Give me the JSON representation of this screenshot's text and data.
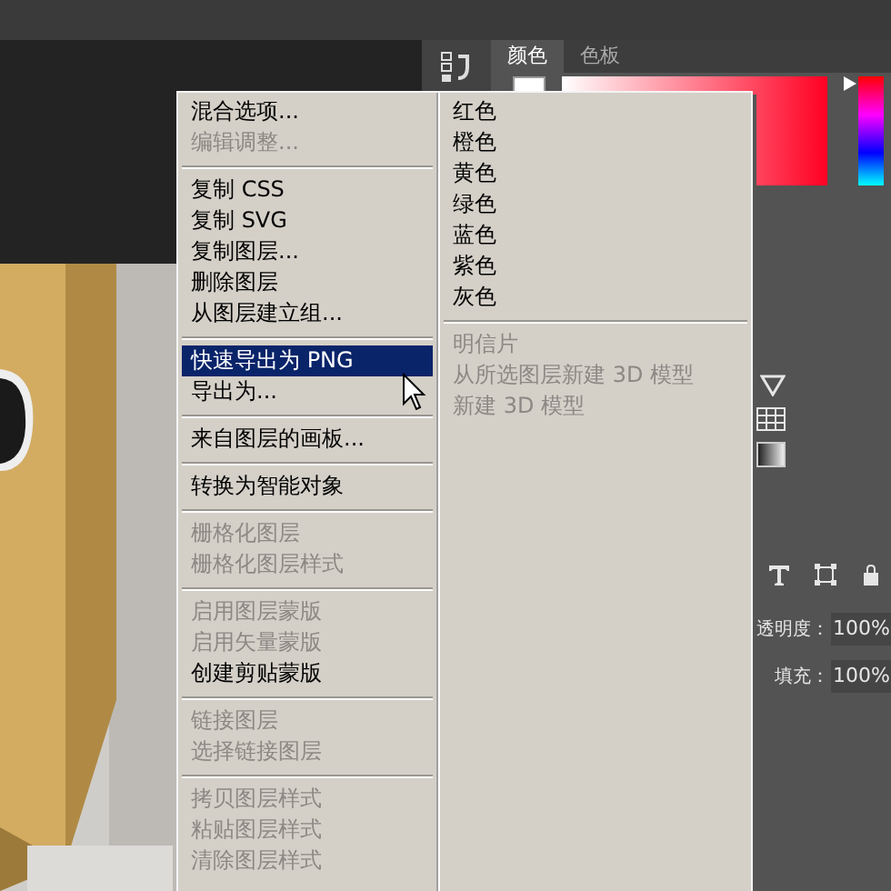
{
  "panel_tabs": [
    {
      "label": "颜色",
      "selected": true
    },
    {
      "label": "色板",
      "selected": false
    }
  ],
  "context_menu": {
    "columns": [
      {
        "items": [
          {
            "kind": "item",
            "label": "混合选项...",
            "disabled": false,
            "selected": false
          },
          {
            "kind": "item",
            "label": "编辑调整...",
            "disabled": true,
            "selected": false
          },
          {
            "kind": "separator"
          },
          {
            "kind": "item",
            "label": "复制 CSS",
            "disabled": false,
            "selected": false
          },
          {
            "kind": "item",
            "label": "复制 SVG",
            "disabled": false,
            "selected": false
          },
          {
            "kind": "item",
            "label": "复制图层...",
            "disabled": false,
            "selected": false
          },
          {
            "kind": "item",
            "label": "删除图层",
            "disabled": false,
            "selected": false
          },
          {
            "kind": "item",
            "label": "从图层建立组...",
            "disabled": false,
            "selected": false
          },
          {
            "kind": "separator"
          },
          {
            "kind": "item",
            "label": "快速导出为 PNG",
            "disabled": false,
            "selected": true
          },
          {
            "kind": "item",
            "label": "导出为...",
            "disabled": false,
            "selected": false
          },
          {
            "kind": "separator"
          },
          {
            "kind": "item",
            "label": "来自图层的画板...",
            "disabled": false,
            "selected": false
          },
          {
            "kind": "separator"
          },
          {
            "kind": "item",
            "label": "转换为智能对象",
            "disabled": false,
            "selected": false
          },
          {
            "kind": "separator"
          },
          {
            "kind": "item",
            "label": "栅格化图层",
            "disabled": true,
            "selected": false
          },
          {
            "kind": "item",
            "label": "栅格化图层样式",
            "disabled": true,
            "selected": false
          },
          {
            "kind": "separator"
          },
          {
            "kind": "item",
            "label": "启用图层蒙版",
            "disabled": true,
            "selected": false
          },
          {
            "kind": "item",
            "label": "启用矢量蒙版",
            "disabled": true,
            "selected": false
          },
          {
            "kind": "item",
            "label": "创建剪贴蒙版",
            "disabled": false,
            "selected": false
          },
          {
            "kind": "separator"
          },
          {
            "kind": "item",
            "label": "链接图层",
            "disabled": true,
            "selected": false
          },
          {
            "kind": "item",
            "label": "选择链接图层",
            "disabled": true,
            "selected": false
          },
          {
            "kind": "separator"
          },
          {
            "kind": "item",
            "label": "拷贝图层样式",
            "disabled": true,
            "selected": false
          },
          {
            "kind": "item",
            "label": "粘贴图层样式",
            "disabled": true,
            "selected": false
          },
          {
            "kind": "item",
            "label": "清除图层样式",
            "disabled": true,
            "selected": false
          }
        ]
      },
      {
        "items": [
          {
            "kind": "item",
            "label": "红色",
            "disabled": false,
            "selected": false
          },
          {
            "kind": "item",
            "label": "橙色",
            "disabled": false,
            "selected": false
          },
          {
            "kind": "item",
            "label": "黄色",
            "disabled": false,
            "selected": false
          },
          {
            "kind": "item",
            "label": "绿色",
            "disabled": false,
            "selected": false
          },
          {
            "kind": "item",
            "label": "蓝色",
            "disabled": false,
            "selected": false
          },
          {
            "kind": "item",
            "label": "紫色",
            "disabled": false,
            "selected": false
          },
          {
            "kind": "item",
            "label": "灰色",
            "disabled": false,
            "selected": false
          },
          {
            "kind": "separator"
          },
          {
            "kind": "item",
            "label": "明信片",
            "disabled": true,
            "selected": false
          },
          {
            "kind": "item",
            "label": "从所选图层新建 3D 模型",
            "disabled": true,
            "selected": false
          },
          {
            "kind": "item",
            "label": "新建 3D 模型",
            "disabled": true,
            "selected": false
          }
        ]
      }
    ]
  },
  "layers_panel": {
    "opacity": {
      "label": "透明度：",
      "value": "100%"
    },
    "fill": {
      "label": "填充：",
      "value": "100%"
    }
  }
}
